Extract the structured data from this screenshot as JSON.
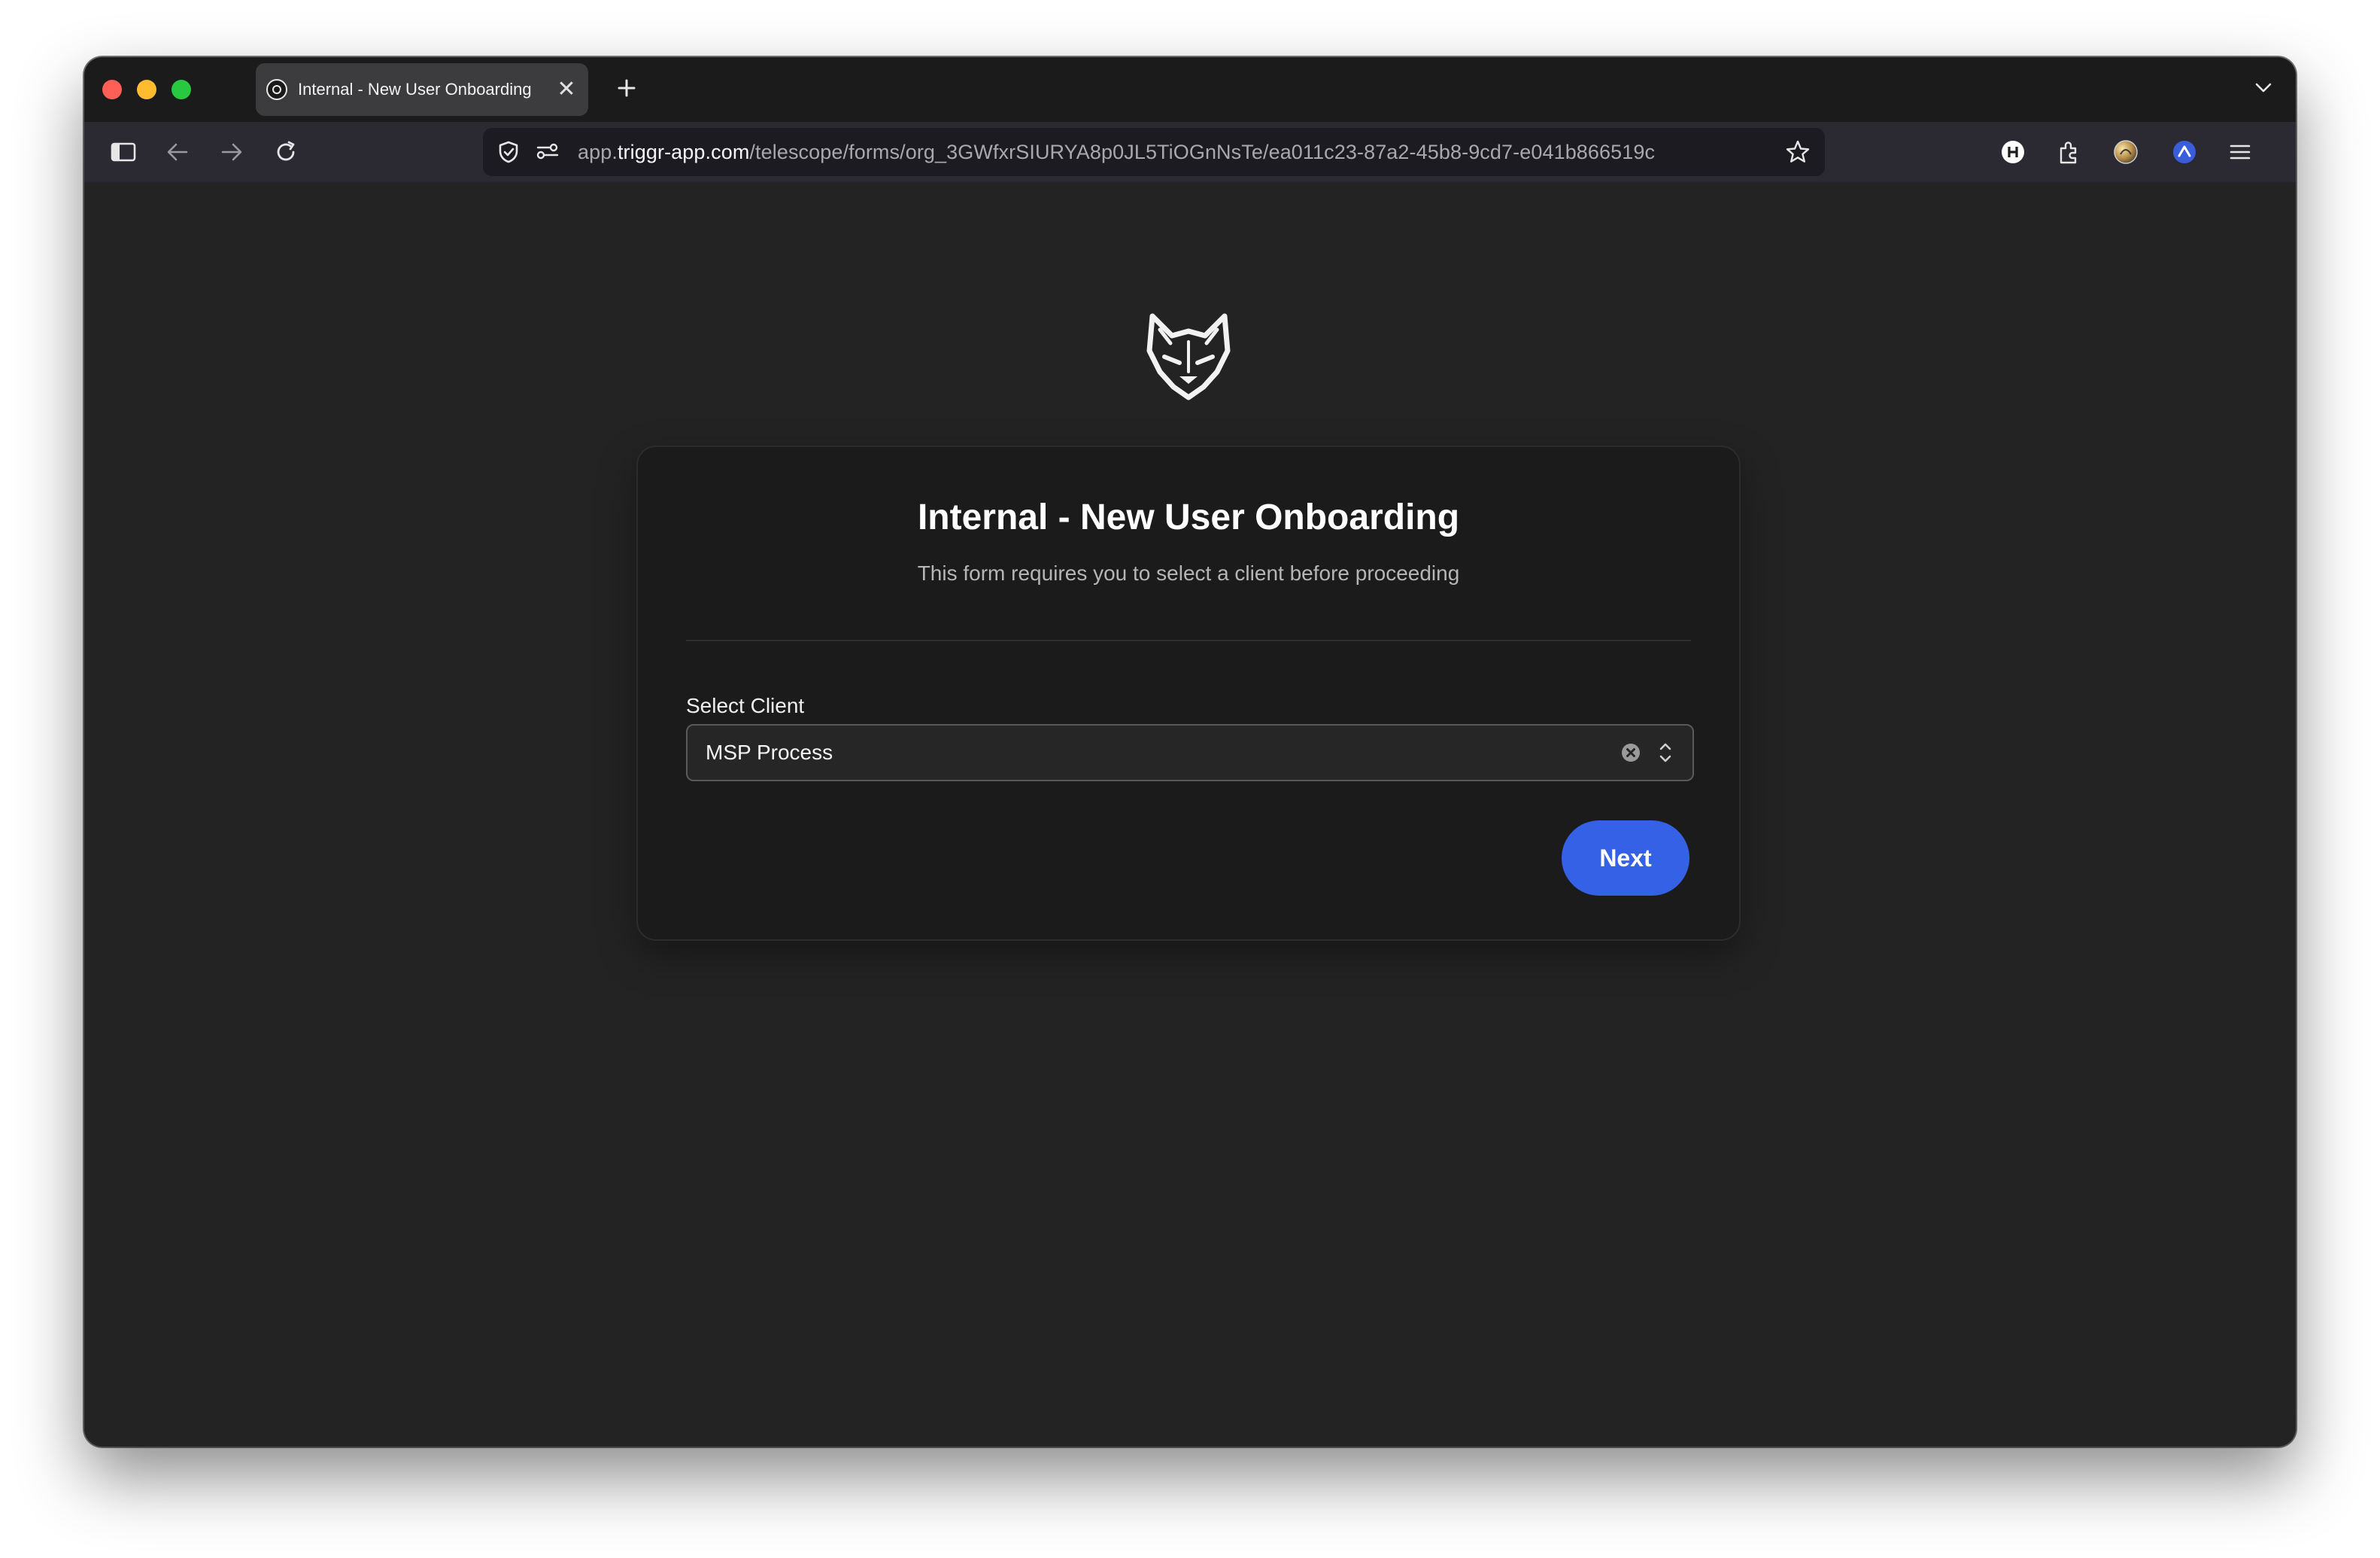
{
  "browser": {
    "tab": {
      "title": "Internal - New User Onboarding",
      "close_glyph": "✕"
    },
    "new_tab_glyph": "+",
    "url": {
      "prefix": "app.",
      "domain": "triggr-app.com",
      "path": "/telescope/forms/org_3GWfxrSIURYA8p0JL5TiOGnNsTe/ea011c23-87a2-45b8-9cd7-e041b866519c"
    },
    "icons": [
      "sidebar-toggle-icon",
      "back-arrow-icon",
      "forward-arrow-icon",
      "reload-icon",
      "shield-icon",
      "permissions-icon",
      "bookmark-star-icon",
      "h-extension-icon",
      "extensions-puzzle-icon",
      "gradient-extension-icon",
      "blue-extension-icon",
      "menu-icon",
      "tab-list-chevron-icon"
    ]
  },
  "page": {
    "logo": "wolf-logo",
    "title": "Internal - New User Onboarding",
    "subtitle": "This form requires you to select a client before proceeding",
    "field": {
      "label": "Select Client",
      "value": "MSP Process"
    },
    "next_label": "Next"
  },
  "colors": {
    "page_background": "#232323",
    "card_background": "#1b1b1b",
    "accent": "#3461e6",
    "text": "#ffffff",
    "muted_text": "#b6b6b6"
  }
}
